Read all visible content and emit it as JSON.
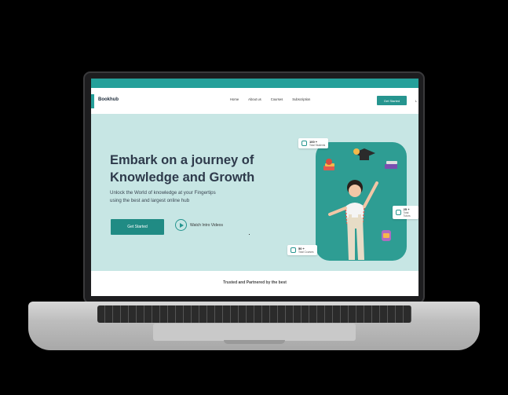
{
  "nav": {
    "logo": "Bookhub",
    "links": [
      "Home",
      "About us",
      "Courses",
      "Subscription"
    ],
    "cta": "Get Started",
    "edge_text": "L"
  },
  "hero": {
    "title_line1": "Embark on a journey of",
    "title_line2": "Knowledge and Growth",
    "subtitle_line1": "Unlock the World of knowledge at your Fingertips",
    "subtitle_line2": "using the best and largest online hub",
    "cta": "Get Started",
    "watch_label": "Watch Intro Videos"
  },
  "stats": [
    {
      "num": "100 +",
      "label": "Total Students",
      "icon": "student-icon"
    },
    {
      "num": "25 +",
      "label": "Total Tutors",
      "icon": "tutor-icon"
    },
    {
      "num": "50 +",
      "label": "Total Courses",
      "icon": "book-icon"
    }
  ],
  "trusted": "Trusted and Partnered by the best",
  "colors": {
    "accent": "#25a09a",
    "hero_bg": "#c7e6e4",
    "button": "#208b84",
    "title": "#2e3a4b"
  }
}
